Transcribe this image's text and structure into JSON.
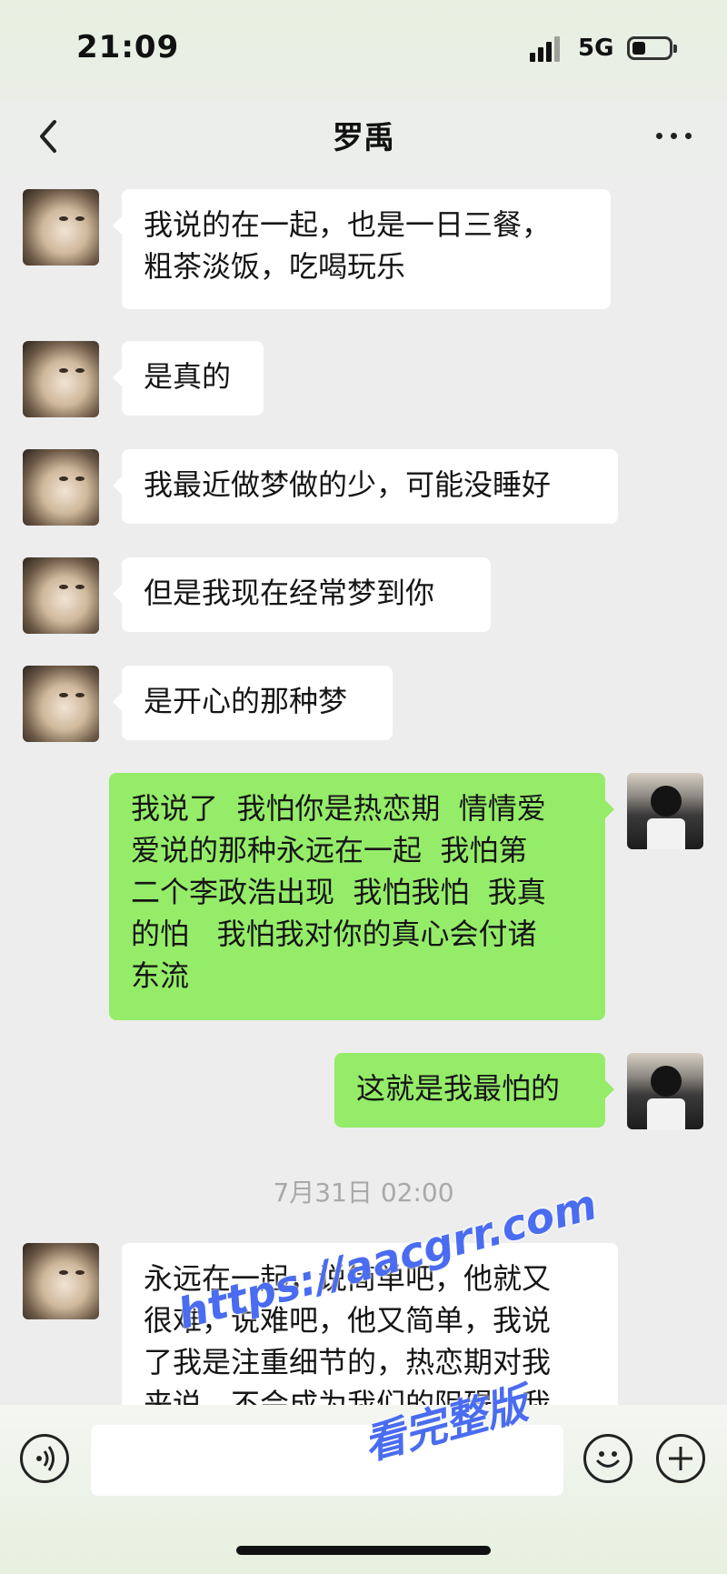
{
  "status_bar": {
    "time": "21:09",
    "network": "5G"
  },
  "header": {
    "title": "罗禹",
    "back_icon": "chevron-left-icon",
    "more_icon": "more-dots-icon"
  },
  "messages": [
    {
      "side": "in",
      "text": "我说的在一起，也是一日三餐，\n粗茶淡饭，吃喝玩乐"
    },
    {
      "side": "in",
      "text": "是真的"
    },
    {
      "side": "in",
      "text": "我最近做梦做的少，可能没睡好"
    },
    {
      "side": "in",
      "text": "但是我现在经常梦到你"
    },
    {
      "side": "in",
      "text": "是开心的那种梦"
    },
    {
      "side": "out",
      "text": "我说了  我怕你是热恋期  情情爱\n爱说的那种永远在一起  我怕第\n二个李政浩出现  我怕我怕  我真\n的怕   我怕我对你的真心会付诸\n东流"
    },
    {
      "side": "out",
      "text": "这就是我最怕的"
    },
    {
      "side": "in",
      "text": "永远在一起，说简单吧，他就又\n很难，说难吧，他又简单，我说\n了我是注重细节的，热恋期对我\n来说，不会成为我们的阻碍，我"
    }
  ],
  "timestamp": "7月31日 02:00",
  "input_bar": {
    "voice_icon": "voice-icon",
    "emoji_icon": "emoji-icon",
    "plus_icon": "plus-icon",
    "text_value": ""
  },
  "watermark": {
    "url": "https://aacgrr.com",
    "caption": "看完整版"
  }
}
